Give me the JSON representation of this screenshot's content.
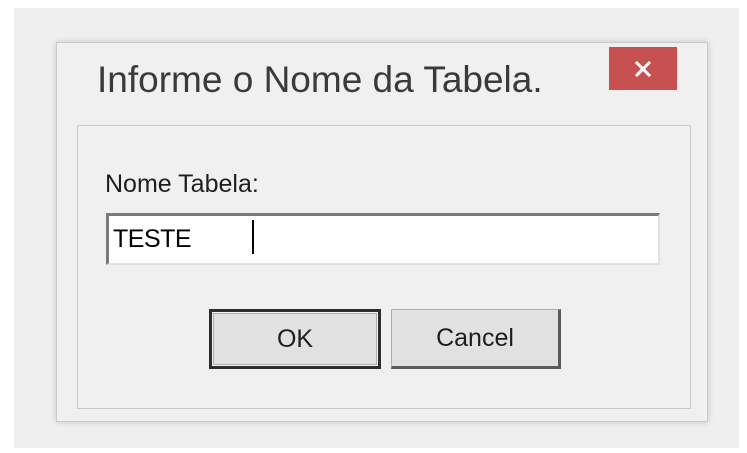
{
  "dialog": {
    "title": "Informe o Nome da Tabela.",
    "close_icon": "close-icon",
    "close_color": "#c75050",
    "field_label": "Nome Tabela:",
    "field_value": "TESTE",
    "ok_label": "OK",
    "cancel_label": "Cancel"
  }
}
